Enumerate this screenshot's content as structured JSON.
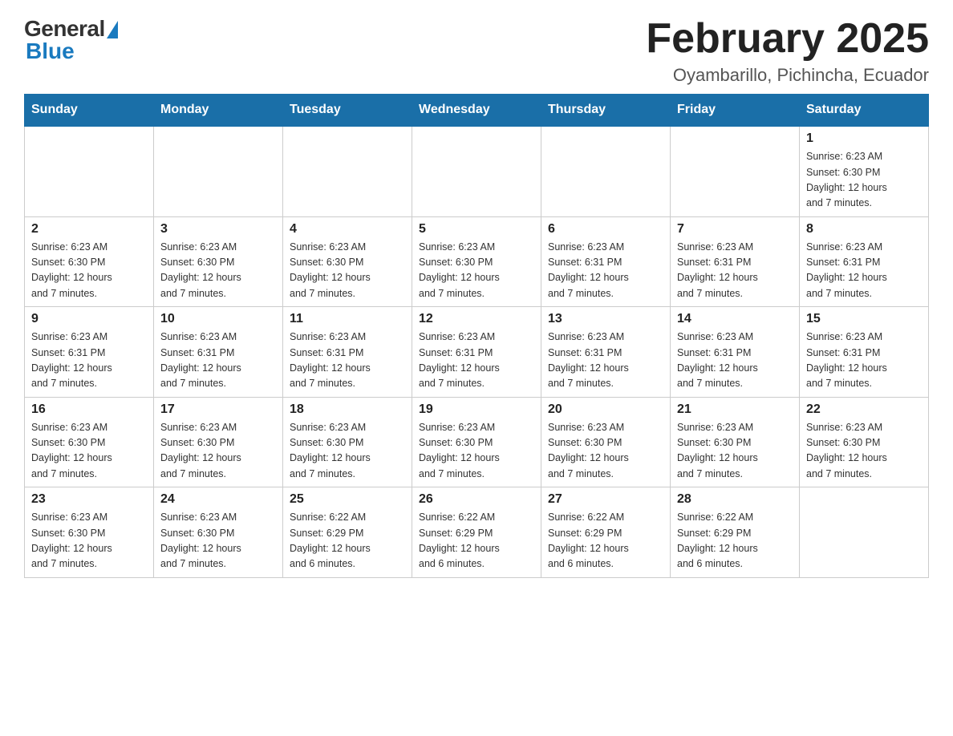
{
  "logo": {
    "general": "General",
    "blue": "Blue"
  },
  "title": "February 2025",
  "subtitle": "Oyambarillo, Pichincha, Ecuador",
  "days_of_week": [
    "Sunday",
    "Monday",
    "Tuesday",
    "Wednesday",
    "Thursday",
    "Friday",
    "Saturday"
  ],
  "weeks": [
    [
      {
        "day": "",
        "info": ""
      },
      {
        "day": "",
        "info": ""
      },
      {
        "day": "",
        "info": ""
      },
      {
        "day": "",
        "info": ""
      },
      {
        "day": "",
        "info": ""
      },
      {
        "day": "",
        "info": ""
      },
      {
        "day": "1",
        "info": "Sunrise: 6:23 AM\nSunset: 6:30 PM\nDaylight: 12 hours\nand 7 minutes."
      }
    ],
    [
      {
        "day": "2",
        "info": "Sunrise: 6:23 AM\nSunset: 6:30 PM\nDaylight: 12 hours\nand 7 minutes."
      },
      {
        "day": "3",
        "info": "Sunrise: 6:23 AM\nSunset: 6:30 PM\nDaylight: 12 hours\nand 7 minutes."
      },
      {
        "day": "4",
        "info": "Sunrise: 6:23 AM\nSunset: 6:30 PM\nDaylight: 12 hours\nand 7 minutes."
      },
      {
        "day": "5",
        "info": "Sunrise: 6:23 AM\nSunset: 6:30 PM\nDaylight: 12 hours\nand 7 minutes."
      },
      {
        "day": "6",
        "info": "Sunrise: 6:23 AM\nSunset: 6:31 PM\nDaylight: 12 hours\nand 7 minutes."
      },
      {
        "day": "7",
        "info": "Sunrise: 6:23 AM\nSunset: 6:31 PM\nDaylight: 12 hours\nand 7 minutes."
      },
      {
        "day": "8",
        "info": "Sunrise: 6:23 AM\nSunset: 6:31 PM\nDaylight: 12 hours\nand 7 minutes."
      }
    ],
    [
      {
        "day": "9",
        "info": "Sunrise: 6:23 AM\nSunset: 6:31 PM\nDaylight: 12 hours\nand 7 minutes."
      },
      {
        "day": "10",
        "info": "Sunrise: 6:23 AM\nSunset: 6:31 PM\nDaylight: 12 hours\nand 7 minutes."
      },
      {
        "day": "11",
        "info": "Sunrise: 6:23 AM\nSunset: 6:31 PM\nDaylight: 12 hours\nand 7 minutes."
      },
      {
        "day": "12",
        "info": "Sunrise: 6:23 AM\nSunset: 6:31 PM\nDaylight: 12 hours\nand 7 minutes."
      },
      {
        "day": "13",
        "info": "Sunrise: 6:23 AM\nSunset: 6:31 PM\nDaylight: 12 hours\nand 7 minutes."
      },
      {
        "day": "14",
        "info": "Sunrise: 6:23 AM\nSunset: 6:31 PM\nDaylight: 12 hours\nand 7 minutes."
      },
      {
        "day": "15",
        "info": "Sunrise: 6:23 AM\nSunset: 6:31 PM\nDaylight: 12 hours\nand 7 minutes."
      }
    ],
    [
      {
        "day": "16",
        "info": "Sunrise: 6:23 AM\nSunset: 6:30 PM\nDaylight: 12 hours\nand 7 minutes."
      },
      {
        "day": "17",
        "info": "Sunrise: 6:23 AM\nSunset: 6:30 PM\nDaylight: 12 hours\nand 7 minutes."
      },
      {
        "day": "18",
        "info": "Sunrise: 6:23 AM\nSunset: 6:30 PM\nDaylight: 12 hours\nand 7 minutes."
      },
      {
        "day": "19",
        "info": "Sunrise: 6:23 AM\nSunset: 6:30 PM\nDaylight: 12 hours\nand 7 minutes."
      },
      {
        "day": "20",
        "info": "Sunrise: 6:23 AM\nSunset: 6:30 PM\nDaylight: 12 hours\nand 7 minutes."
      },
      {
        "day": "21",
        "info": "Sunrise: 6:23 AM\nSunset: 6:30 PM\nDaylight: 12 hours\nand 7 minutes."
      },
      {
        "day": "22",
        "info": "Sunrise: 6:23 AM\nSunset: 6:30 PM\nDaylight: 12 hours\nand 7 minutes."
      }
    ],
    [
      {
        "day": "23",
        "info": "Sunrise: 6:23 AM\nSunset: 6:30 PM\nDaylight: 12 hours\nand 7 minutes."
      },
      {
        "day": "24",
        "info": "Sunrise: 6:23 AM\nSunset: 6:30 PM\nDaylight: 12 hours\nand 7 minutes."
      },
      {
        "day": "25",
        "info": "Sunrise: 6:22 AM\nSunset: 6:29 PM\nDaylight: 12 hours\nand 6 minutes."
      },
      {
        "day": "26",
        "info": "Sunrise: 6:22 AM\nSunset: 6:29 PM\nDaylight: 12 hours\nand 6 minutes."
      },
      {
        "day": "27",
        "info": "Sunrise: 6:22 AM\nSunset: 6:29 PM\nDaylight: 12 hours\nand 6 minutes."
      },
      {
        "day": "28",
        "info": "Sunrise: 6:22 AM\nSunset: 6:29 PM\nDaylight: 12 hours\nand 6 minutes."
      },
      {
        "day": "",
        "info": ""
      }
    ]
  ]
}
